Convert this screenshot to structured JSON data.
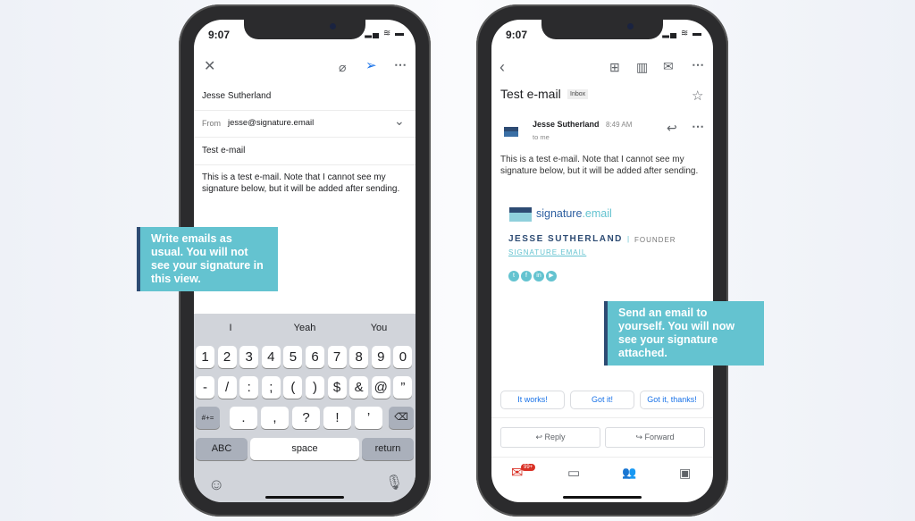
{
  "compose": {
    "time": "9:07",
    "to": "Jesse Sutherland",
    "from_label": "From",
    "from": "jesse@signature.email",
    "subject": "Test e-mail",
    "body": "This is a test e-mail. Note that I cannot see my signature below, but it will be added after sending.",
    "suggestions": [
      "I",
      "Yeah",
      "You"
    ],
    "row1": [
      "1",
      "2",
      "3",
      "4",
      "5",
      "6",
      "7",
      "8",
      "9",
      "0"
    ],
    "row2": [
      "-",
      "/",
      ":",
      ";",
      "(",
      ")",
      "$",
      "&",
      "@",
      "”"
    ],
    "row3": [
      ".",
      ",",
      "?",
      "!",
      "’"
    ],
    "symbols_key": "#+=",
    "abc_key": "ABC",
    "space_key": "space",
    "return_key": "return"
  },
  "callout_left": {
    "text": "Write emails as usual. You will not see your signature in this view."
  },
  "callout_right": {
    "text": "Send an email to yourself. You will now see your signature attached."
  },
  "inbox": {
    "time": "9:07",
    "subject": "Test e-mail",
    "label": "Inbox",
    "sender": "Jesse Sutherland",
    "sent_time": "8:49 AM",
    "to": "to me",
    "body": "This is a test e-mail. Note that I cannot see my signature below, but it will be added after sending.",
    "signature": {
      "logo_main": "signature",
      "logo_ext": ".email",
      "name": "JESSE SUTHERLAND",
      "separator": "|",
      "role": "FOUNDER",
      "link": "SIGNATURE.EMAIL"
    },
    "quick_replies": [
      "It works!",
      "Got it!",
      "Got it, thanks!"
    ],
    "reply": "Reply",
    "forward": "Forward",
    "badge": "99+"
  },
  "colors": {
    "accent": "#64c3d0",
    "navy": "#2d4b73",
    "link": "#1a73e8",
    "mail_red": "#d93025"
  }
}
